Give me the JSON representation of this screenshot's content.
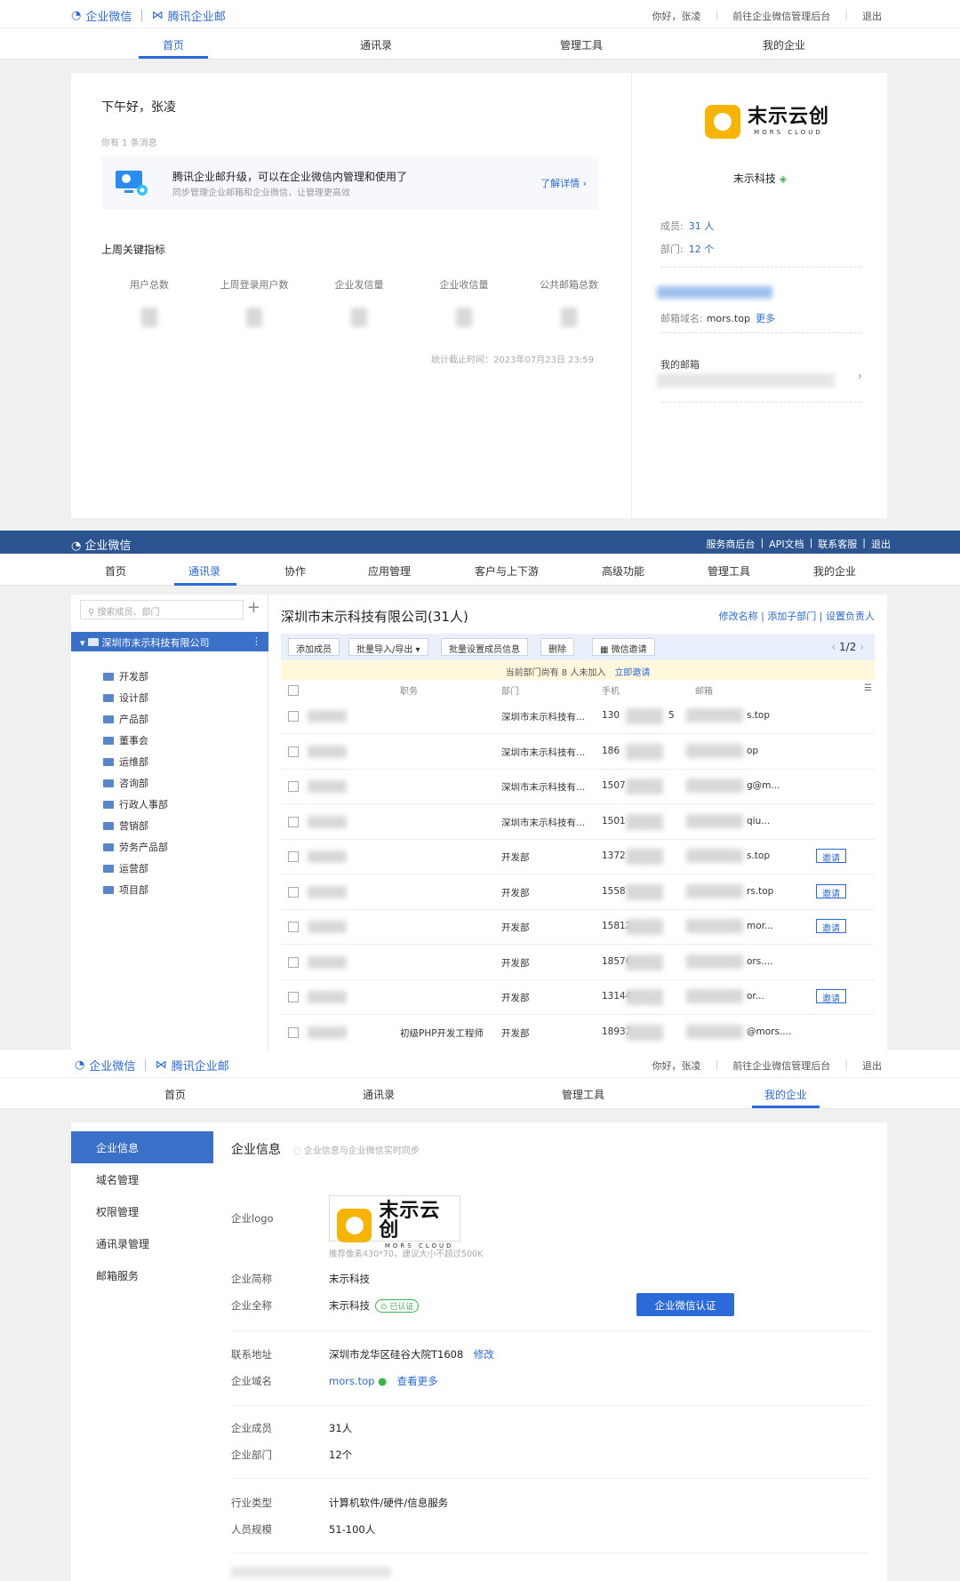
{
  "s1": {
    "brand": {
      "wechat": "企业微信",
      "mail": "腾讯企业邮"
    },
    "top_links": {
      "greeting": "你好，张凌",
      "admin": "前往企业微信管理后台",
      "logout": "退出"
    },
    "nav": [
      "首页",
      "通讯录",
      "管理工具",
      "我的企业"
    ],
    "greeting": "下午好，张凌",
    "message_count": "你有 1 条消息",
    "notice": {
      "title": "腾讯企业邮升级，可以在企业微信内管理和使用了",
      "subtitle": "同步管理企业邮箱和企业微信，让管理更高效",
      "more": "了解详情 ›"
    },
    "kpi_title": "上周关键指标",
    "kpis": [
      "用户总数",
      "上周登录用户数",
      "企业发信量",
      "企业收信量",
      "公共邮箱总数"
    ],
    "stat_time": "统计截止时间：2023年07月23日 23:59",
    "company": {
      "logo_cn": "末示云创",
      "logo_en": "MORS CLOUD",
      "name": "末示科技",
      "members_label": "成员:",
      "members": "31 人",
      "depts_label": "部门:",
      "depts": "12 个",
      "domain_label": "邮箱域名:",
      "domain": "mors.top",
      "domain_more": "更多",
      "mymail_label": "我的邮箱"
    }
  },
  "s2": {
    "brand": "企业微信",
    "top_links": [
      "服务商后台",
      "|",
      "API文档",
      "|",
      "联系客服",
      "|",
      "退出"
    ],
    "nav": [
      "首页",
      "通讯录",
      "协作",
      "应用管理",
      "客户与上下游",
      "高级功能",
      "管理工具",
      "我的企业"
    ],
    "search_placeholder": "搜索成员、部门",
    "plus": "+",
    "root": "深圳市末示科技有限公司",
    "depts": [
      "开发部",
      "设计部",
      "产品部",
      "董事会",
      "运维部",
      "咨询部",
      "行政人事部",
      "营销部",
      "劳务产品部",
      "运营部",
      "项目部"
    ],
    "company_title": "深圳市末示科技有限公司(31人)",
    "company_links": "修改名称 | 添加子部门 | 设置负责人",
    "toolbar": [
      "添加成员",
      "批量导入/导出 ▾",
      "批量设置成员信息",
      "删除",
      "微信邀请"
    ],
    "pager": "1/2",
    "invite_bar": "当前部门尚有 8 人未加入",
    "invite_now": "立即邀请",
    "headers": [
      "职务",
      "部门",
      "手机",
      "邮箱"
    ],
    "invite_label": "邀请",
    "rows": [
      {
        "title": "",
        "dept": "深圳市末示科技有...",
        "phone": "130",
        "phone_end": "5",
        "mail": "s.top",
        "invite": false
      },
      {
        "title": "",
        "dept": "深圳市末示科技有...",
        "phone": "186",
        "phone_end": "",
        "mail": "op",
        "invite": false
      },
      {
        "title": "",
        "dept": "深圳市末示科技有...",
        "phone": "1507",
        "phone_end": "",
        "mail": "g@m...",
        "invite": false
      },
      {
        "title": "",
        "dept": "深圳市末示科技有...",
        "phone": "1501",
        "phone_end": "",
        "mail": "qiu...",
        "invite": false
      },
      {
        "title": "",
        "dept": "开发部",
        "phone": "1372",
        "phone_end": "",
        "mail": "s.top",
        "invite": true
      },
      {
        "title": "",
        "dept": "开发部",
        "phone": "1558",
        "phone_end": "",
        "mail": "rs.top",
        "invite": true
      },
      {
        "title": "",
        "dept": "开发部",
        "phone": "15812",
        "phone_end": "",
        "mail": "mor...",
        "invite": true
      },
      {
        "title": "",
        "dept": "开发部",
        "phone": "18576",
        "phone_end": "",
        "mail": "ors....",
        "invite": false
      },
      {
        "title": "",
        "dept": "开发部",
        "phone": "13144",
        "phone_end": "",
        "mail": "or...",
        "invite": true
      },
      {
        "title": "初级PHP开发工程师",
        "dept": "开发部",
        "phone": "18932",
        "phone_end": "",
        "mail": "@mors....",
        "invite": false
      }
    ]
  },
  "s3": {
    "menu": [
      "企业信息",
      "域名管理",
      "权限管理",
      "通讯录管理",
      "邮箱服务"
    ],
    "title": "企业信息",
    "subtitle": "企业信息与企业微信实时同步",
    "logo_label": "企业logo",
    "logo_hint": "推荐像素430*70，建议大小不超过500K",
    "short_name_label": "企业简称",
    "short_name": "末示科技",
    "full_name_label": "企业全称",
    "full_name": "末示科技",
    "verified": "已认证",
    "auth_button": "企业微信认证",
    "address_label": "联系地址",
    "address": "深圳市龙华区硅谷大院T1608",
    "edit": "修改",
    "domain_label": "企业域名",
    "domain": "mors.top",
    "see_more": "查看更多",
    "members_label": "企业成员",
    "members": "31人",
    "depts_label": "企业部门",
    "depts": "12个",
    "industry_label": "行业类型",
    "industry": "计算机软件/硬件/信息服务",
    "size_label": "人员规模",
    "size": "51-100人"
  },
  "colors": {
    "accent": "#2b6ad9",
    "dark_header": "#2c5491",
    "tree_active": "#3a70c8",
    "ok_green": "#3bb54a",
    "logo_yellow": "#f6b400"
  }
}
